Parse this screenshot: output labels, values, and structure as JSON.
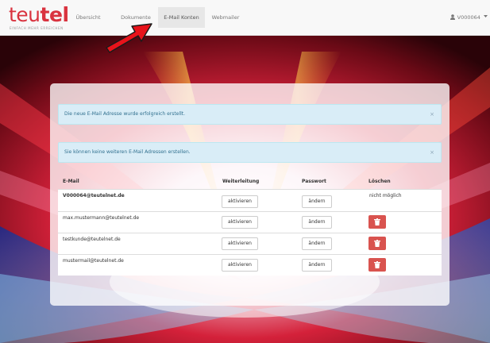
{
  "brand": {
    "name_light": "teu",
    "name_bold": "tel",
    "tagline": "EINFACH MEHR ERREICHEN",
    "color": "#d9333f"
  },
  "nav": {
    "items": [
      {
        "label": "Übersicht",
        "active": false
      },
      {
        "label": "Dokumente",
        "active": false
      },
      {
        "label": "E-Mail Konten",
        "active": true
      },
      {
        "label": "Webmailer",
        "active": false
      }
    ],
    "user": "V000064"
  },
  "alerts": [
    {
      "text": "Die neue E-Mail Adresse wurde erfolgreich erstellt.",
      "close": "×"
    },
    {
      "text": "Sie können keine weiteren E-Mail Adressen erstellen.",
      "close": "×"
    }
  ],
  "table": {
    "headers": {
      "email": "E-Mail",
      "forward": "Weiterleitung",
      "password": "Passwort",
      "delete": "Löschen"
    },
    "rows": [
      {
        "email": "V000064@teutelnet.de",
        "forward": "aktivieren",
        "password": "ändern",
        "delete": "nicht möglich"
      },
      {
        "email": "max.mustermann@teutelnet.de",
        "forward": "aktivieren",
        "password": "ändern",
        "delete_icon": "trash-icon"
      },
      {
        "email": "testkunde@teutelnet.de",
        "forward": "aktivieren",
        "password": "ändern",
        "delete_icon": "trash-icon"
      },
      {
        "email": "mustermail@teutelnet.de",
        "forward": "aktivieren",
        "password": "ändern",
        "delete_icon": "trash-icon"
      }
    ]
  },
  "colors": {
    "alert_bg": "#d9edf7",
    "alert_text": "#31708f",
    "danger": "#d9534f",
    "annotation_arrow": "#e8131b"
  }
}
